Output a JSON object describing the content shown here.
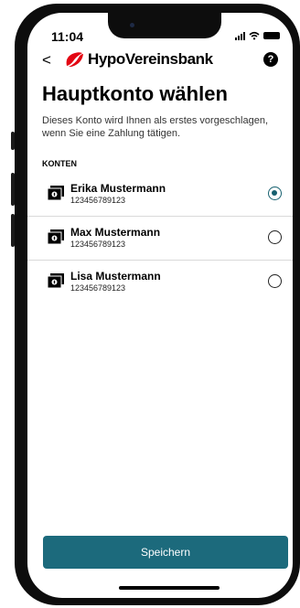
{
  "status": {
    "time": "11:04"
  },
  "header": {
    "back_label": "<",
    "brand": "HypoVereinsbank",
    "help_label": "?"
  },
  "page": {
    "title": "Hauptkonto wählen",
    "subtitle": "Dieses Konto wird Ihnen als erstes vorgeschlagen, wenn Sie eine Zahlung tätigen.",
    "section_label": "KONTEN"
  },
  "accounts": [
    {
      "name": "Erika Mustermann",
      "number": "123456789123",
      "selected": true
    },
    {
      "name": "Max Mustermann",
      "number": "123456789123",
      "selected": false
    },
    {
      "name": "Lisa Mustermann",
      "number": "123456789123",
      "selected": false
    }
  ],
  "actions": {
    "save_label": "Speichern"
  },
  "colors": {
    "accent": "#1c6a7c",
    "brand_red": "#e30613"
  },
  "icons": {
    "back": "chevron-left-icon",
    "brand": "hvb-logo-icon",
    "help": "question-icon",
    "account": "account-card-icon",
    "signal": "signal-icon",
    "wifi": "wifi-icon",
    "battery": "battery-icon"
  }
}
